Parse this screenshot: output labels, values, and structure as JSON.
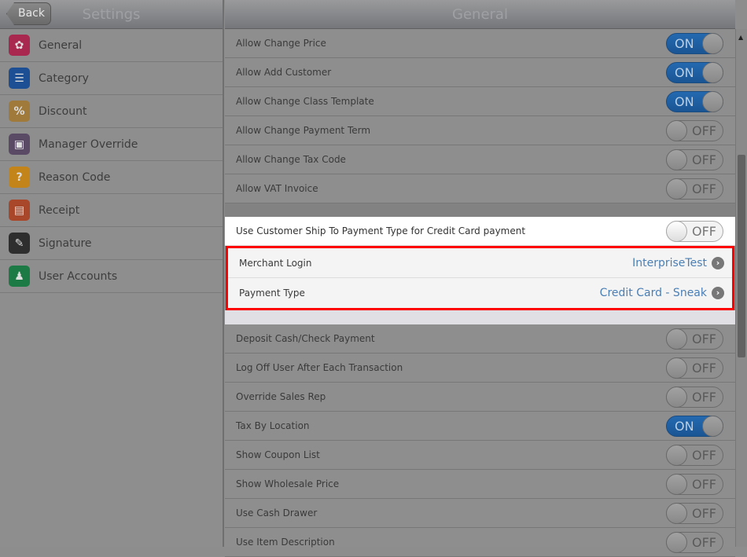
{
  "left": {
    "back": "Back",
    "title": "Settings",
    "items": [
      {
        "label": "General",
        "icon": "gear-icon",
        "color": "#a8284f",
        "glyph": "✿"
      },
      {
        "label": "Category",
        "icon": "list-icon",
        "color": "#1c4f93",
        "glyph": "☰"
      },
      {
        "label": "Discount",
        "icon": "tag-icon",
        "color": "#a07a3a",
        "glyph": "%"
      },
      {
        "label": "Manager Override",
        "icon": "badge-icon",
        "color": "#5a4a66",
        "glyph": "▣"
      },
      {
        "label": "Reason Code",
        "icon": "question-icon",
        "color": "#c38419",
        "glyph": "?"
      },
      {
        "label": "Receipt",
        "icon": "receipt-icon",
        "color": "#a8472a",
        "glyph": "▤"
      },
      {
        "label": "Signature",
        "icon": "pen-icon",
        "color": "#2e2e2e",
        "glyph": "✎"
      },
      {
        "label": "User Accounts",
        "icon": "user-icon",
        "color": "#1c7a45",
        "glyph": "♟"
      }
    ]
  },
  "right": {
    "title": "General",
    "group1": [
      {
        "label": "Allow Change Price",
        "state": "ON"
      },
      {
        "label": "Allow Add Customer",
        "state": "ON"
      },
      {
        "label": "Allow Change Class Template",
        "state": "ON"
      },
      {
        "label": "Allow Change Payment Term",
        "state": "OFF"
      },
      {
        "label": "Allow Change Tax Code",
        "state": "OFF"
      },
      {
        "label": "Allow VAT Invoice",
        "state": "OFF"
      }
    ],
    "credit": {
      "label": "Use Customer Ship To Payment Type for Credit Card payment",
      "state": "OFF"
    },
    "merchant": {
      "label": "Merchant Login",
      "value": "InterpriseTest"
    },
    "payment": {
      "label": "Payment Type",
      "value": "Credit Card - Sneak"
    },
    "group2": [
      {
        "label": "Deposit Cash/Check Payment",
        "state": "OFF"
      },
      {
        "label": "Log Off User After Each Transaction",
        "state": "OFF"
      },
      {
        "label": "Override Sales Rep",
        "state": "OFF"
      },
      {
        "label": "Tax By Location",
        "state": "ON"
      },
      {
        "label": "Show Coupon List",
        "state": "OFF"
      },
      {
        "label": "Show Wholesale Price",
        "state": "OFF"
      },
      {
        "label": "Use Cash Drawer",
        "state": "OFF"
      },
      {
        "label": "Use Item Description",
        "state": "OFF"
      }
    ]
  }
}
